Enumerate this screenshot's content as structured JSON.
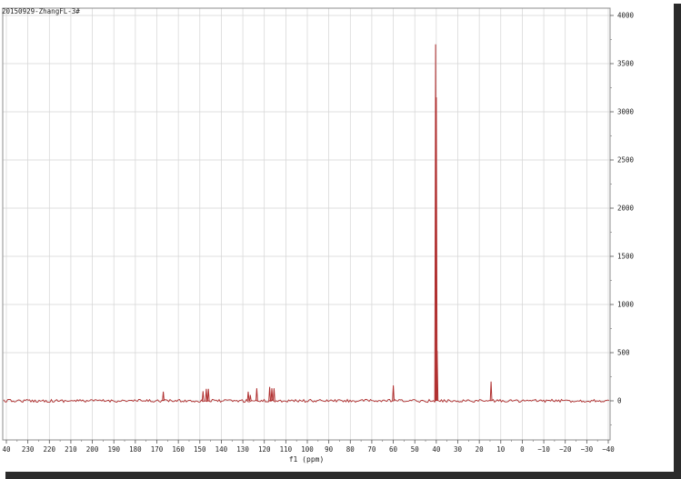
{
  "chart_data": {
    "type": "line",
    "title": "20150929-ZhangFL-3#",
    "xlabel": "f1 (ppm)",
    "ylabel": "",
    "xlim": [
      240,
      -40
    ],
    "ylim": [
      -400,
      4050
    ],
    "x_reversed": true,
    "grid": true,
    "x_ticks": [
      240,
      230,
      220,
      210,
      200,
      190,
      180,
      170,
      160,
      150,
      140,
      130,
      120,
      110,
      100,
      90,
      80,
      70,
      60,
      50,
      40,
      30,
      20,
      10,
      0,
      -10,
      -20,
      -30,
      -40
    ],
    "x_tick_labels": [
      "40",
      "230",
      "220",
      "210",
      "200",
      "190",
      "180",
      "170",
      "160",
      "150",
      "140",
      "130",
      "120",
      "110",
      "100",
      "90",
      "80",
      "70",
      "60",
      "50",
      "40",
      "30",
      "20",
      "10",
      "0",
      "−10",
      "−20",
      "−30",
      "−40"
    ],
    "y_ticks": [
      0,
      500,
      1000,
      1500,
      2000,
      2500,
      3000,
      3500,
      4000
    ],
    "y_tick_labels": [
      "0",
      "500",
      "1000",
      "1500",
      "2000",
      "2500",
      "3000",
      "3500",
      "4000"
    ],
    "series": [
      {
        "values_note": "",
        "color": "#b03030",
        "peaks": [
          {
            "x": 167.0,
            "y": 95
          },
          {
            "x": 148.5,
            "y": 100
          },
          {
            "x": 147.0,
            "y": 125
          },
          {
            "x": 146.0,
            "y": 125
          },
          {
            "x": 127.5,
            "y": 95
          },
          {
            "x": 126.5,
            "y": 60
          },
          {
            "x": 123.5,
            "y": 130
          },
          {
            "x": 117.5,
            "y": 145
          },
          {
            "x": 116.5,
            "y": 130
          },
          {
            "x": 115.5,
            "y": 130
          },
          {
            "x": 60.0,
            "y": 160
          },
          {
            "x": 40.3,
            "y": 3700
          },
          {
            "x": 40.0,
            "y": 3150
          },
          {
            "x": 39.6,
            "y": 520
          },
          {
            "x": 14.5,
            "y": 200
          }
        ]
      }
    ]
  },
  "colors": {
    "spectrum": "#b03030",
    "grid": "#d4d4d4",
    "frame": "#8c8c8c",
    "text": "#222222"
  }
}
